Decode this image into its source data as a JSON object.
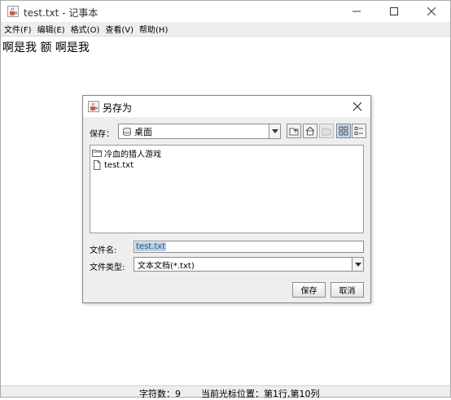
{
  "window": {
    "title": "test.txt - 记事本",
    "icon": "java-cup-icon"
  },
  "menubar": {
    "items": [
      "文件(F)",
      "编辑(E)",
      "格式(O)",
      "查看(V)",
      "帮助(H)"
    ]
  },
  "editor": {
    "content": "啊是我 额 啊是我"
  },
  "statusbar": {
    "char_count": "字符数：9",
    "cursor_position": "当前光标位置：第1行,第10列"
  },
  "dialog": {
    "title": "另存为",
    "save_in_label": "保存：",
    "save_in_value": "桌面",
    "files": [
      {
        "name": "冷血的猎人游戏",
        "type": "folder"
      },
      {
        "name": "test.txt",
        "type": "file"
      }
    ],
    "file_name_label": "文件名:",
    "file_name_value": "test.txt",
    "file_type_label": "文件类型:",
    "file_type_value": "文本文档(*.txt)",
    "save_button": "保存",
    "cancel_button": "取消"
  },
  "colors": {
    "dialog_bg": "#eeeeee",
    "selection": "#b8cfe5",
    "active_toggle": "#c8d6e6"
  }
}
